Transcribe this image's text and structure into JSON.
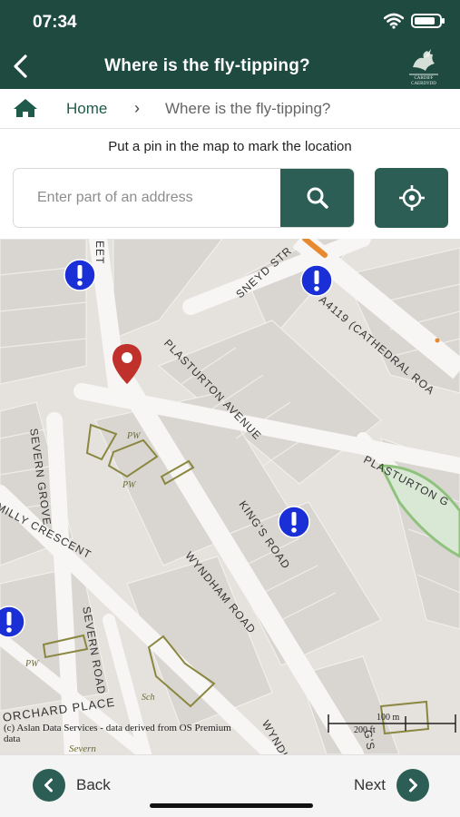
{
  "status_bar": {
    "time": "07:34"
  },
  "header": {
    "title": "Where is the fly-tipping?",
    "logo_text": "CARDIFF CAERDYDD"
  },
  "breadcrumb": {
    "home": "Home",
    "separator": "›",
    "current": "Where is the fly-tipping?"
  },
  "instruction": "Put a pin in the map to mark the location",
  "search": {
    "placeholder": "Enter part of an address",
    "value": ""
  },
  "map": {
    "road_labels": {
      "eet": "EET",
      "sneyd": "SNEYD STR",
      "a4119": "A4119 (CATHEDRAL ROA",
      "plasturton_avenue": "PLASTURTON AVENUE",
      "plasturton_g": "PLASTURTON G",
      "severn_grove": "SEVERN GROVE",
      "milly_crescent": "MILLY CRESCENT",
      "kings_road": "KING'S ROAD",
      "wyndham_road": "WYNDHAM ROAD",
      "severn_road": "SEVERN ROAD",
      "orchard_place": "ORCHARD PLACE",
      "wyndh": "WYNDH",
      "kings_short": "G'S",
      "severn_small": "Severn"
    },
    "pw_labels": [
      "PW",
      "PW",
      "PW"
    ],
    "sch_label": "Sch",
    "attribution": "(c) Aslan Data Services - data derived from OS Premium data",
    "scale": {
      "label_100": "100 m",
      "label_200": "200 ft"
    }
  },
  "footer": {
    "back": "Back",
    "next": "Next"
  },
  "colors": {
    "header": "#1f4a40",
    "button": "#2c5e56",
    "marker": "#1b2fd6",
    "pin": "#c0312b",
    "link": "#1f5a4a"
  },
  "icons": {
    "back": "chevron-left-icon",
    "home": "home-icon",
    "search": "search-icon",
    "locate": "crosshair-icon",
    "report": "exclamation-icon",
    "pin": "map-pin-icon"
  }
}
